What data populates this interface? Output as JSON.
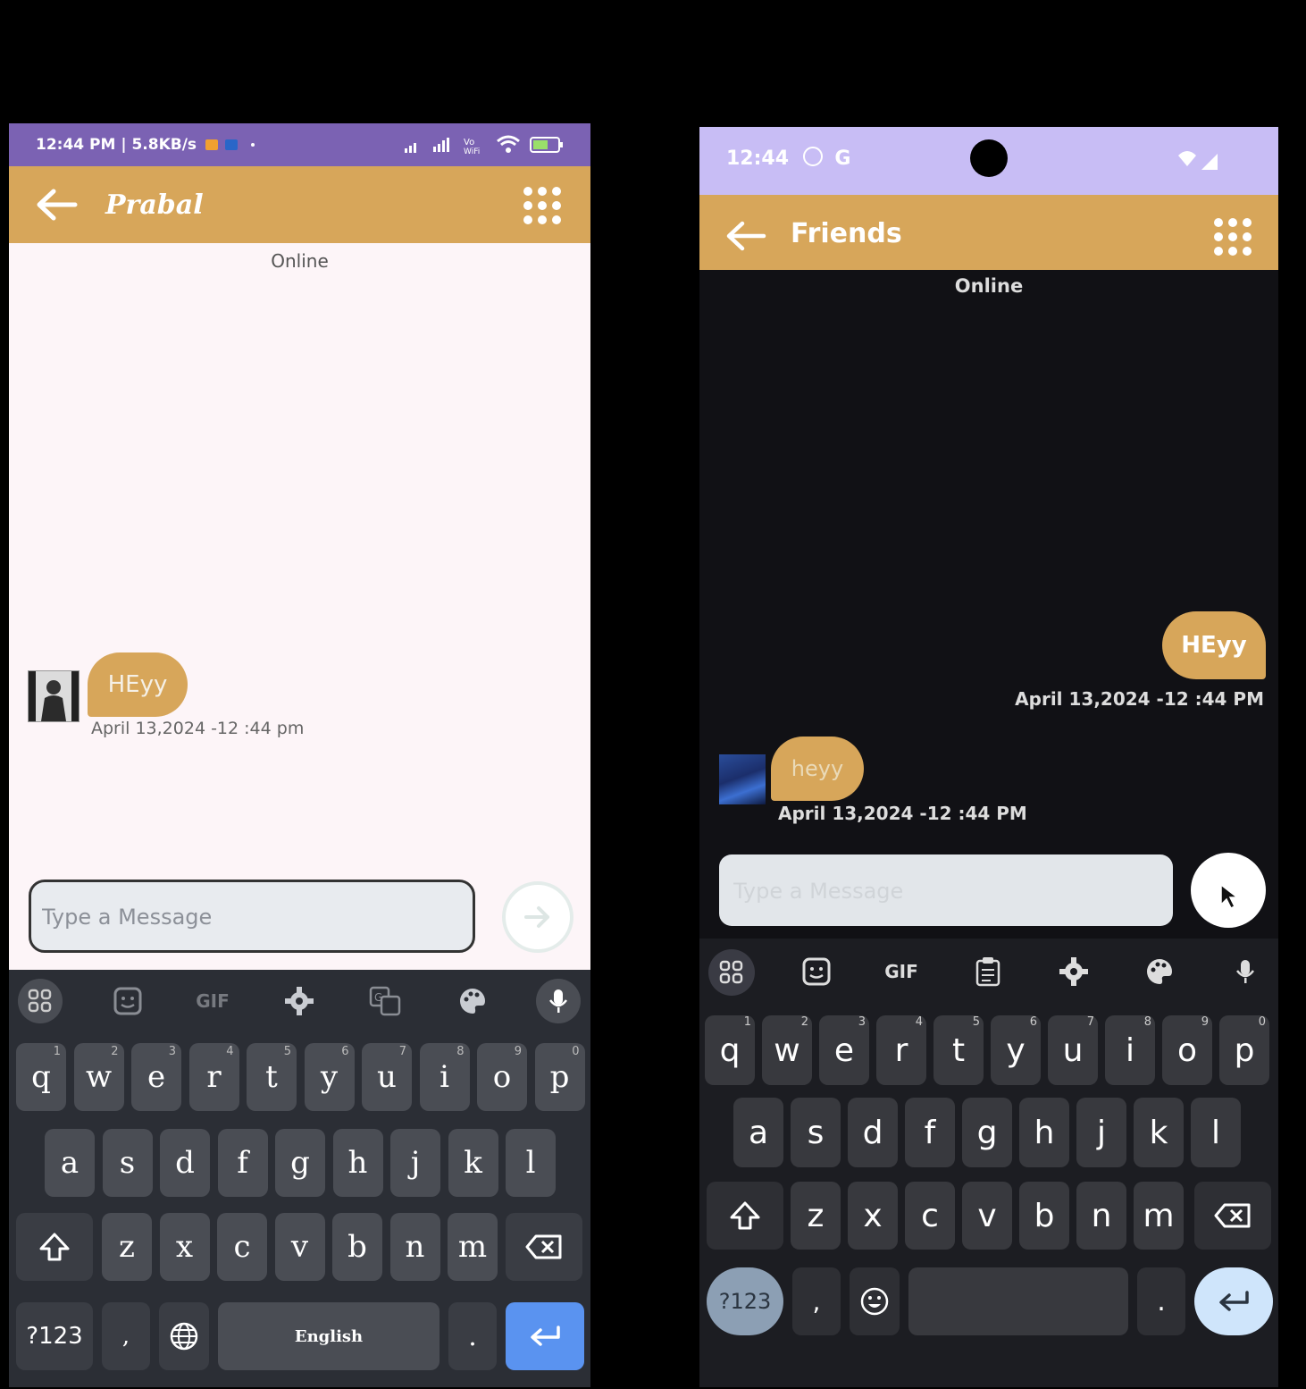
{
  "left_phone": {
    "status_time": "12:44 PM | 5.8KB/s",
    "contact_name": "Prabal",
    "presence": "Online",
    "messages": [
      {
        "text": "HEyy",
        "timestamp": "April 13,2024 -12 :44 pm",
        "direction": "received"
      }
    ],
    "input_placeholder": "Type a Message",
    "keyboard": {
      "toolbar": [
        "apps-icon",
        "sticker-icon",
        "GIF",
        "settings-icon",
        "translate-icon",
        "palette-icon",
        "mic-icon"
      ],
      "gif_label": "GIF",
      "row1": [
        "q",
        "w",
        "e",
        "r",
        "t",
        "y",
        "u",
        "i",
        "o",
        "p"
      ],
      "row1_nums": [
        "1",
        "2",
        "3",
        "4",
        "5",
        "6",
        "7",
        "8",
        "9",
        "0"
      ],
      "row2": [
        "a",
        "s",
        "d",
        "f",
        "g",
        "h",
        "j",
        "k",
        "l"
      ],
      "row3": [
        "z",
        "x",
        "c",
        "v",
        "b",
        "n",
        "m"
      ],
      "symbols_label": "?123",
      "comma": ",",
      "space_label": "English",
      "period": "."
    }
  },
  "right_phone": {
    "status_time": "12:44",
    "status_extra": "G",
    "contact_name": "Friends",
    "presence": "Online",
    "messages": [
      {
        "text": "HEyy",
        "timestamp": "April 13,2024 -12 :44 PM",
        "direction": "sent"
      },
      {
        "text": "heyy",
        "timestamp": "April 13,2024 -12 :44 PM",
        "direction": "received"
      }
    ],
    "input_placeholder": "Type a Message",
    "keyboard": {
      "gif_label": "GIF",
      "row1": [
        "q",
        "w",
        "e",
        "r",
        "t",
        "y",
        "u",
        "i",
        "o",
        "p"
      ],
      "row1_nums": [
        "1",
        "2",
        "3",
        "4",
        "5",
        "6",
        "7",
        "8",
        "9",
        "0"
      ],
      "row2": [
        "a",
        "s",
        "d",
        "f",
        "g",
        "h",
        "j",
        "k",
        "l"
      ],
      "row3": [
        "z",
        "x",
        "c",
        "v",
        "b",
        "n",
        "m"
      ],
      "symbols_label": "?123",
      "comma": ",",
      "period": "."
    }
  },
  "colors": {
    "accent": "#d7a65a",
    "left_status_bar": "#7b62b3",
    "right_status_bar": "#c8bdf5",
    "enter_key": "#5a93f0"
  }
}
